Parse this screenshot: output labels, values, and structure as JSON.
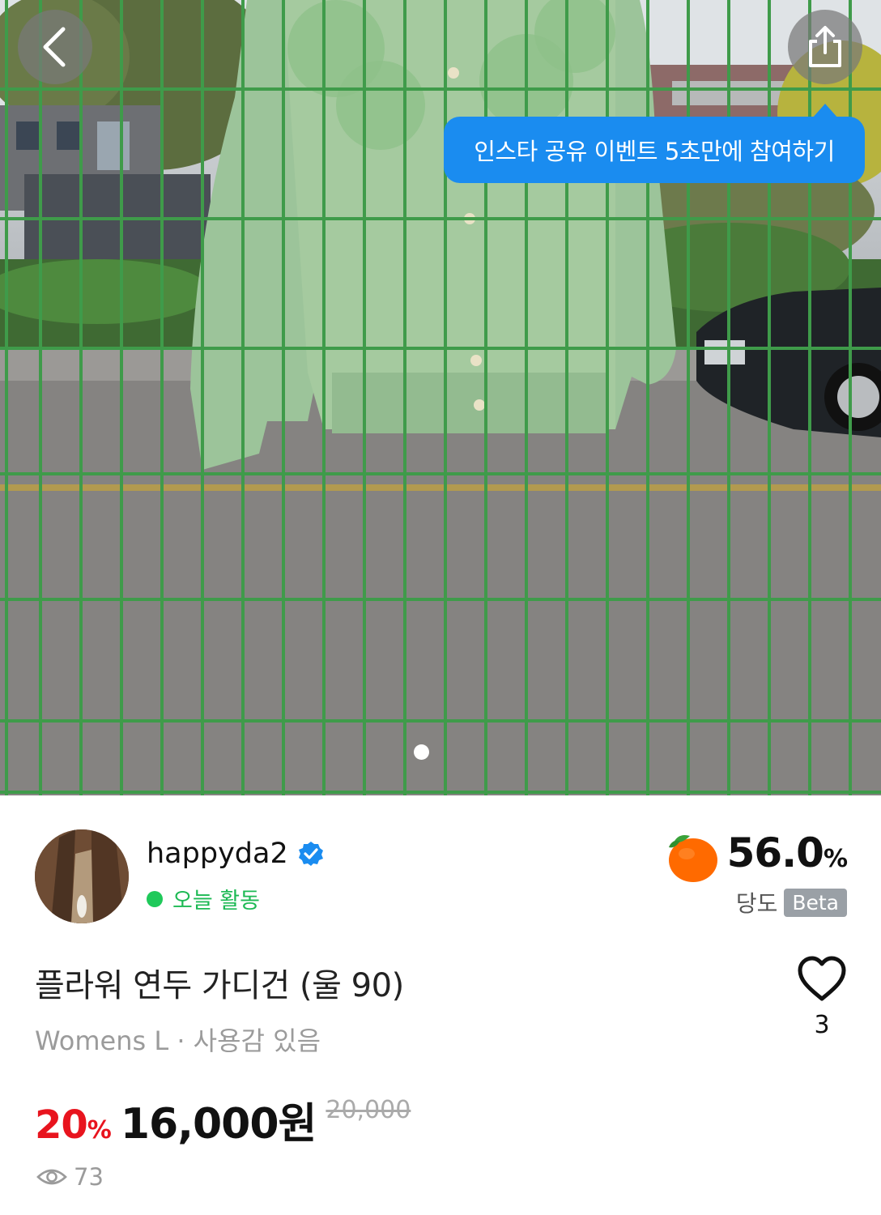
{
  "header": {
    "back_icon": "chevron-left-icon",
    "share_icon": "share-icon",
    "share_tooltip": "인스타 공유 이벤트 5초만에 참여하기"
  },
  "gallery": {
    "current_page": 1,
    "total_pages": 1
  },
  "seller": {
    "name": "happyda2",
    "verified": true,
    "activity": "오늘 활동",
    "activity_color": "#1fc95a"
  },
  "sweetness": {
    "value": "56.0",
    "unit": "%",
    "label": "당도",
    "badge": "Beta",
    "icon": "tangerine-icon"
  },
  "product": {
    "title": "플라워 연두 가디건 (울 90)",
    "meta": "Womens L · 사용감 있음",
    "likes": "3",
    "discount_value": "20",
    "discount_unit": "%",
    "price": "16,000원",
    "original_price": "20,000",
    "views": "73"
  },
  "colors": {
    "accent_blue": "#1a8cf0",
    "discount_red": "#e8141e"
  }
}
